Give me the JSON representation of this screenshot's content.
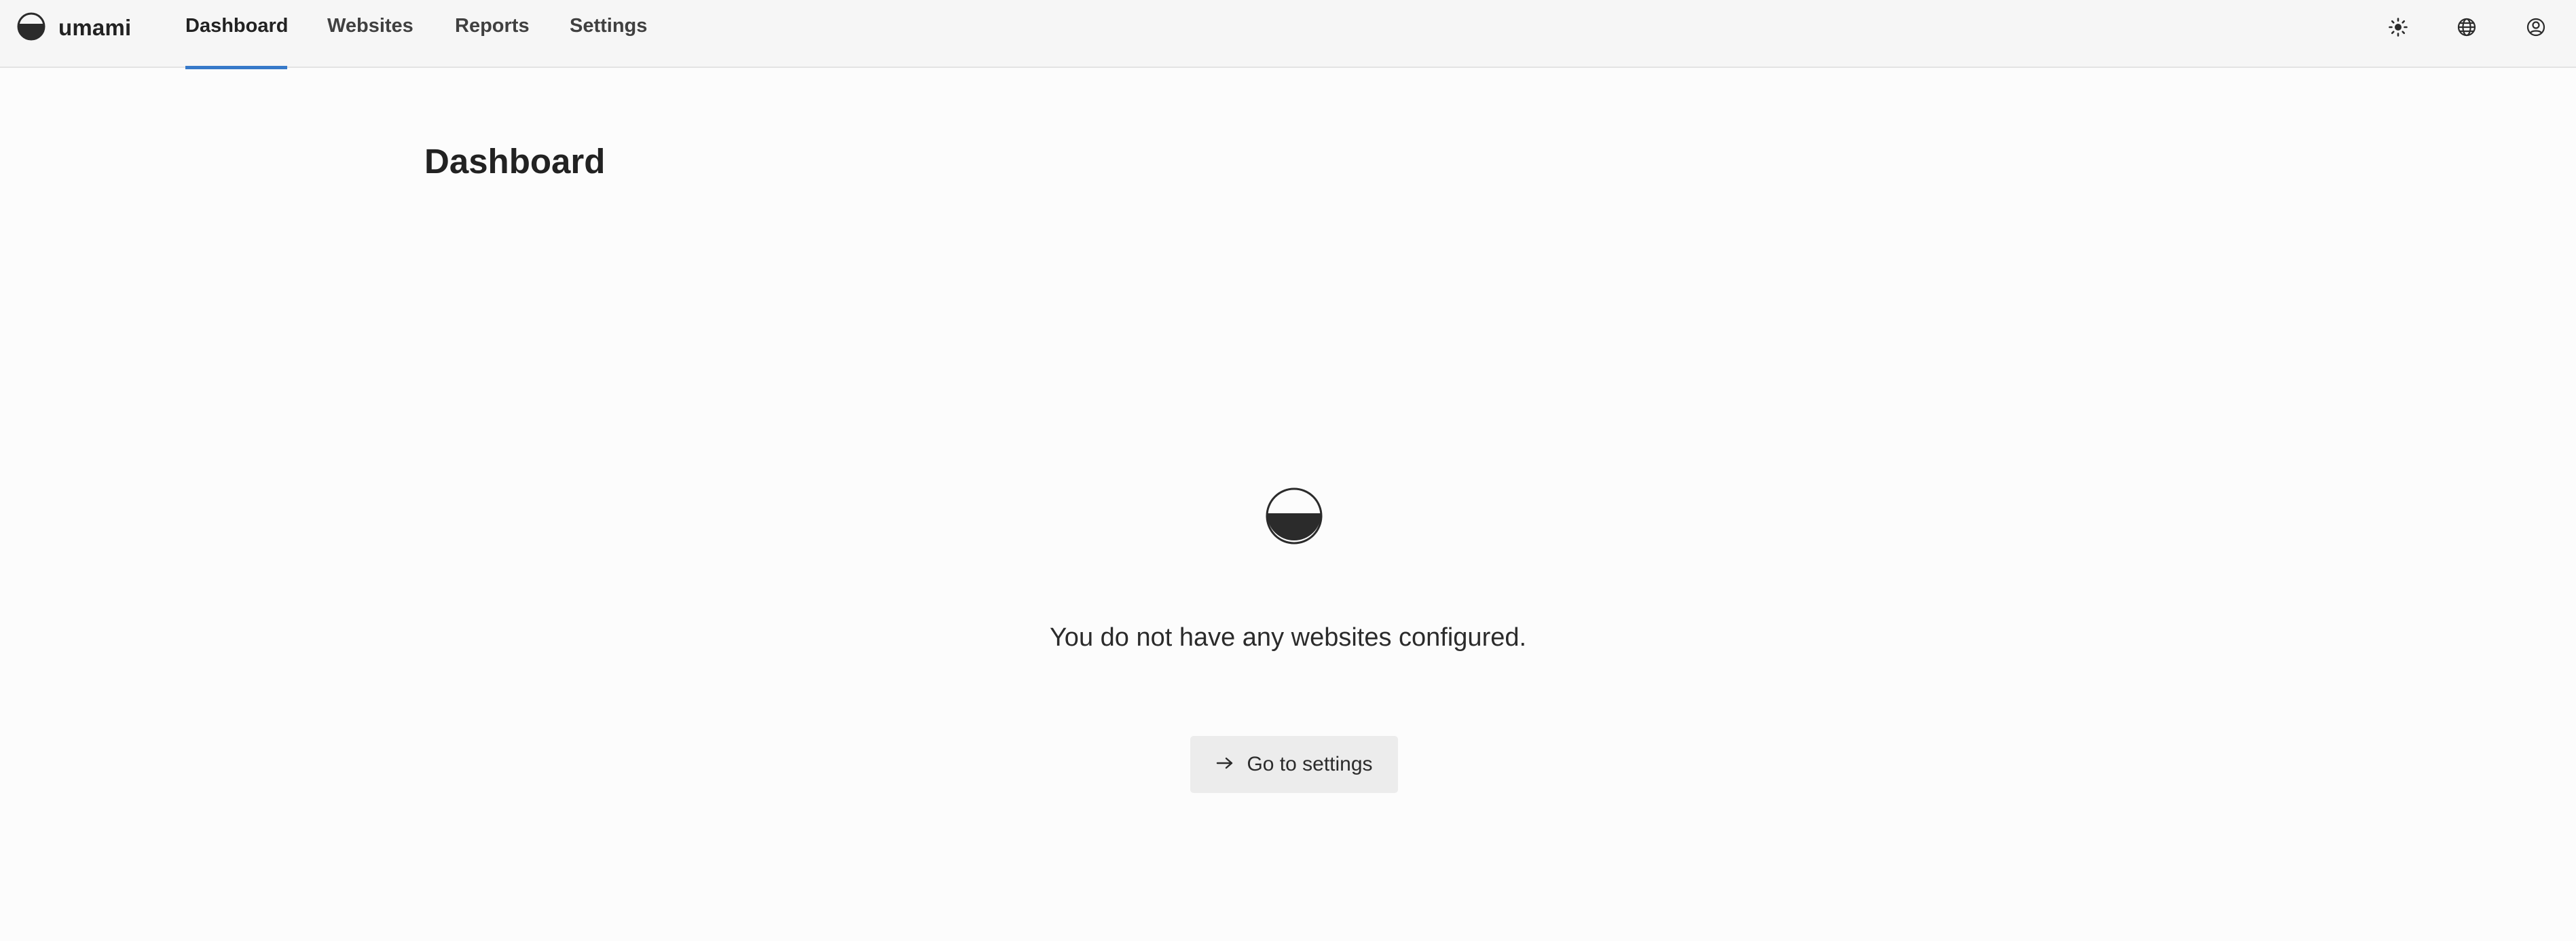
{
  "app": {
    "name": "umami",
    "logo_icon": "umami-logo-icon"
  },
  "nav": {
    "tabs": [
      {
        "label": "Dashboard",
        "active": true
      },
      {
        "label": "Websites",
        "active": false
      },
      {
        "label": "Reports",
        "active": false
      },
      {
        "label": "Settings",
        "active": false
      }
    ]
  },
  "header_actions": {
    "theme_icon": "sun-icon",
    "language_icon": "globe-icon",
    "profile_icon": "user-circle-icon"
  },
  "main": {
    "title": "Dashboard",
    "empty_state": {
      "icon": "umami-logo-icon",
      "message": "You do not have any websites configured.",
      "button_label": "Go to settings",
      "button_icon": "arrow-right-icon"
    }
  },
  "colors": {
    "accent": "#3779c9",
    "header_bg": "#f6f6f6",
    "page_bg": "#fcfcfc",
    "button_bg": "#ececec"
  }
}
